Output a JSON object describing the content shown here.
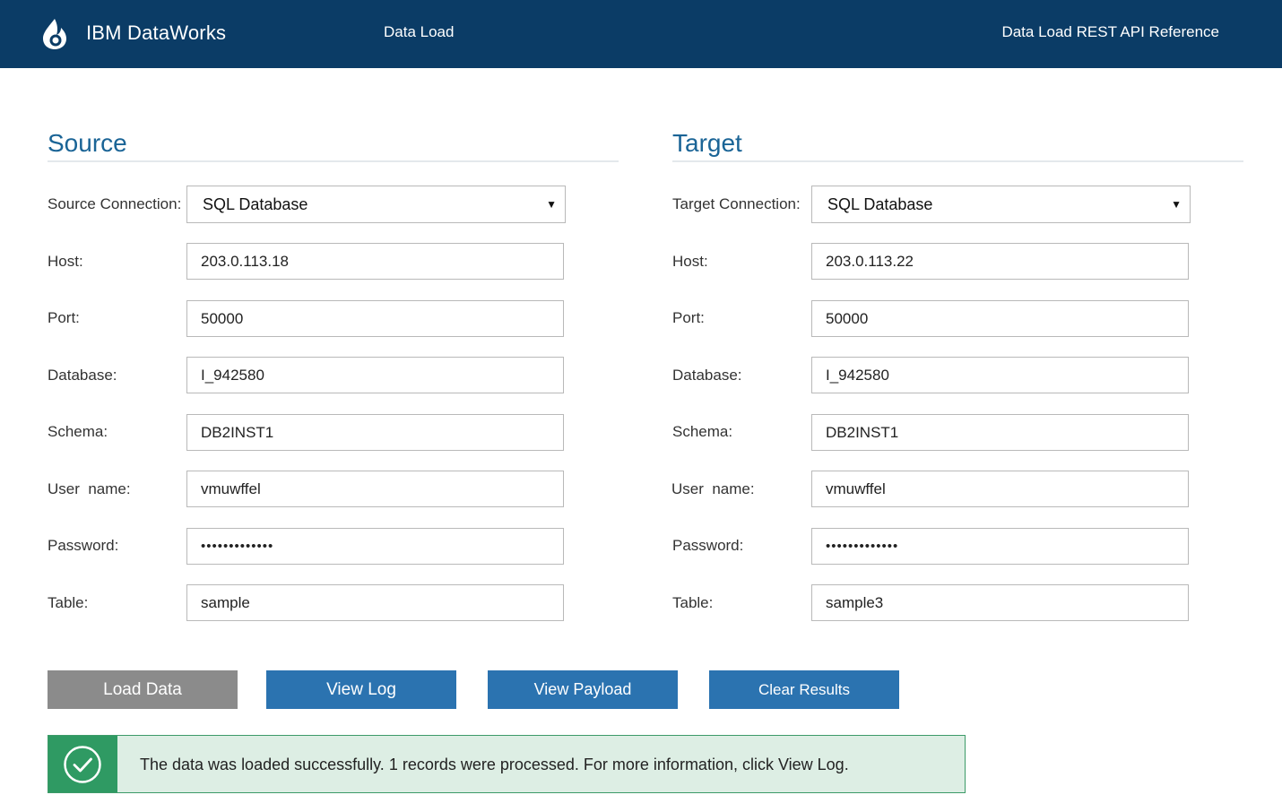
{
  "header": {
    "brand": "IBM DataWorks",
    "nav_data_load": "Data Load",
    "nav_api_reference": "Data Load REST API Reference"
  },
  "source": {
    "title": "Source",
    "connection_label": "Source Connection:",
    "connection_value": "SQL Database",
    "host_label": "Host:",
    "host_value": "203.0.113.18",
    "port_label": "Port:",
    "port_value": "50000",
    "database_label": "Database:",
    "database_value": "I_942580",
    "schema_label": "Schema:",
    "schema_value": "DB2INST1",
    "username_label": "User  name:",
    "username_value": "vmuwffel",
    "password_label": "Password:",
    "password_value": "•••••••••••••",
    "table_label": "Table:",
    "table_value": "sample"
  },
  "target": {
    "title": "Target",
    "connection_label": "Target Connection:",
    "connection_value": "SQL Database",
    "host_label": "Host:",
    "host_value": "203.0.113.22",
    "port_label": "Port:",
    "port_value": "50000",
    "database_label": "Database:",
    "database_value": "I_942580",
    "schema_label": "Schema:",
    "schema_value": "DB2INST1",
    "username_label": "User  name:",
    "username_value": "vmuwffel",
    "password_label": "Password:",
    "password_value": "•••••••••••••",
    "table_label": "Table:",
    "table_value": "sample3"
  },
  "buttons": {
    "load_data": "Load Data",
    "view_log": "View Log",
    "view_payload": "View Payload",
    "clear_results": "Clear Results"
  },
  "alert": {
    "message": "The data was loaded successfully. 1 records were processed. For more information, click View Log."
  },
  "icons": {
    "logo": "flame-drop-icon",
    "select_arrow": "▼",
    "alert": "checkmark-circle-icon"
  },
  "colors": {
    "header_bg": "#0b3c66",
    "section_title": "#1a6496",
    "button_blue": "#2b73b0",
    "button_disabled": "#8b8b8b",
    "success_green": "#2f9a63",
    "success_bg": "#ddeee4"
  }
}
